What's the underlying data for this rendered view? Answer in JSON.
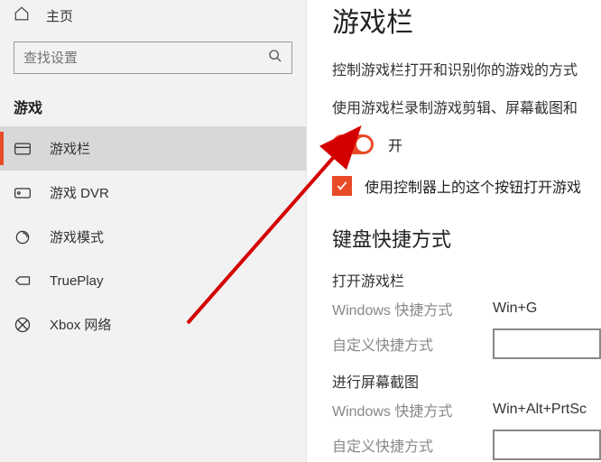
{
  "sidebar": {
    "home_label": "主页",
    "search_placeholder": "查找设置",
    "section_title": "游戏",
    "items": [
      {
        "label": "游戏栏"
      },
      {
        "label": "游戏 DVR"
      },
      {
        "label": "游戏模式"
      },
      {
        "label": "TruePlay"
      },
      {
        "label": "Xbox 网络"
      }
    ]
  },
  "main": {
    "title": "游戏栏",
    "desc1": "控制游戏栏打开和识别你的游戏的方式",
    "desc2": "使用游戏栏录制游戏剪辑、屏幕截图和",
    "toggle_label": "开",
    "checkbox_label": "使用控制器上的这个按钮打开游戏",
    "shortcuts_heading": "键盘快捷方式",
    "group1_title": "打开游戏栏",
    "windows_shortcut_label": "Windows 快捷方式",
    "custom_shortcut_label": "自定义快捷方式",
    "group1_value": "Win+G",
    "group2_title": "进行屏幕截图",
    "group2_value": "Win+Alt+PrtSc"
  }
}
